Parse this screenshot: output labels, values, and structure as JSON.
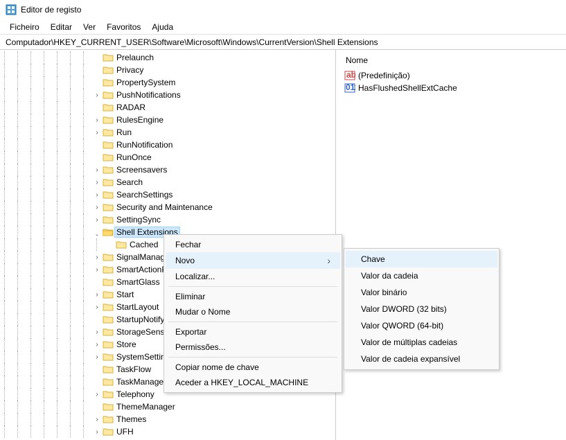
{
  "window": {
    "title": "Editor de registo"
  },
  "menu": {
    "items": [
      "Ficheiro",
      "Editar",
      "Ver",
      "Favoritos",
      "Ajuda"
    ]
  },
  "path": "Computador\\HKEY_CURRENT_USER\\Software\\Microsoft\\Windows\\CurrentVersion\\Shell Extensions",
  "tree": {
    "items": [
      {
        "label": "Prelaunch",
        "expandable": false,
        "depth": 8
      },
      {
        "label": "Privacy",
        "expandable": false,
        "depth": 8
      },
      {
        "label": "PropertySystem",
        "expandable": false,
        "depth": 8
      },
      {
        "label": "PushNotifications",
        "expandable": true,
        "depth": 8
      },
      {
        "label": "RADAR",
        "expandable": false,
        "depth": 8
      },
      {
        "label": "RulesEngine",
        "expandable": true,
        "depth": 8
      },
      {
        "label": "Run",
        "expandable": true,
        "depth": 8
      },
      {
        "label": "RunNotification",
        "expandable": false,
        "depth": 8
      },
      {
        "label": "RunOnce",
        "expandable": false,
        "depth": 8
      },
      {
        "label": "Screensavers",
        "expandable": true,
        "depth": 8
      },
      {
        "label": "Search",
        "expandable": true,
        "depth": 8
      },
      {
        "label": "SearchSettings",
        "expandable": true,
        "depth": 8
      },
      {
        "label": "Security and Maintenance",
        "expandable": true,
        "depth": 8
      },
      {
        "label": "SettingSync",
        "expandable": true,
        "depth": 8
      },
      {
        "label": "Shell Extensions",
        "expandable": true,
        "expanded": true,
        "selected": true,
        "depth": 8
      },
      {
        "label": "Cached",
        "expandable": false,
        "depth": 9
      },
      {
        "label": "SignalManager",
        "expandable": true,
        "depth": 8
      },
      {
        "label": "SmartActionPlat",
        "expandable": true,
        "depth": 8,
        "truncated": true
      },
      {
        "label": "SmartGlass",
        "expandable": false,
        "depth": 8
      },
      {
        "label": "Start",
        "expandable": true,
        "depth": 8
      },
      {
        "label": "StartLayout",
        "expandable": true,
        "depth": 8
      },
      {
        "label": "StartupNotify",
        "expandable": false,
        "depth": 8
      },
      {
        "label": "StorageSense",
        "expandable": true,
        "depth": 8
      },
      {
        "label": "Store",
        "expandable": true,
        "depth": 8
      },
      {
        "label": "SystemSettings",
        "expandable": true,
        "depth": 8
      },
      {
        "label": "TaskFlow",
        "expandable": false,
        "depth": 8
      },
      {
        "label": "TaskManager",
        "expandable": false,
        "depth": 8
      },
      {
        "label": "Telephony",
        "expandable": true,
        "depth": 8
      },
      {
        "label": "ThemeManager",
        "expandable": false,
        "depth": 8
      },
      {
        "label": "Themes",
        "expandable": true,
        "depth": 8
      },
      {
        "label": "UFH",
        "expandable": true,
        "depth": 8
      }
    ]
  },
  "value_pane": {
    "header": "Nome",
    "rows": [
      {
        "icon": "string",
        "label": "(Predefinição)"
      },
      {
        "icon": "binary",
        "label": "HasFlushedShellExtCache"
      }
    ]
  },
  "context_menu": {
    "items": [
      {
        "label": "Fechar"
      },
      {
        "label": "Novo",
        "submenu": true,
        "hover": true
      },
      {
        "label": "Localizar..."
      },
      {
        "sep": true
      },
      {
        "label": "Eliminar"
      },
      {
        "label": "Mudar o Nome"
      },
      {
        "sep": true
      },
      {
        "label": "Exportar"
      },
      {
        "label": "Permissões..."
      },
      {
        "sep": true
      },
      {
        "label": "Copiar nome de chave"
      },
      {
        "label": "Aceder a HKEY_LOCAL_MACHINE"
      }
    ]
  },
  "submenu": {
    "items": [
      {
        "label": "Chave",
        "hover": true
      },
      {
        "sep": true
      },
      {
        "label": "Valor da cadeia"
      },
      {
        "label": "Valor binário"
      },
      {
        "label": "Valor DWORD (32 bits)"
      },
      {
        "label": "Valor QWORD (64-bit)"
      },
      {
        "label": "Valor de múltiplas cadeias"
      },
      {
        "label": "Valor de cadeia expansível"
      }
    ]
  }
}
